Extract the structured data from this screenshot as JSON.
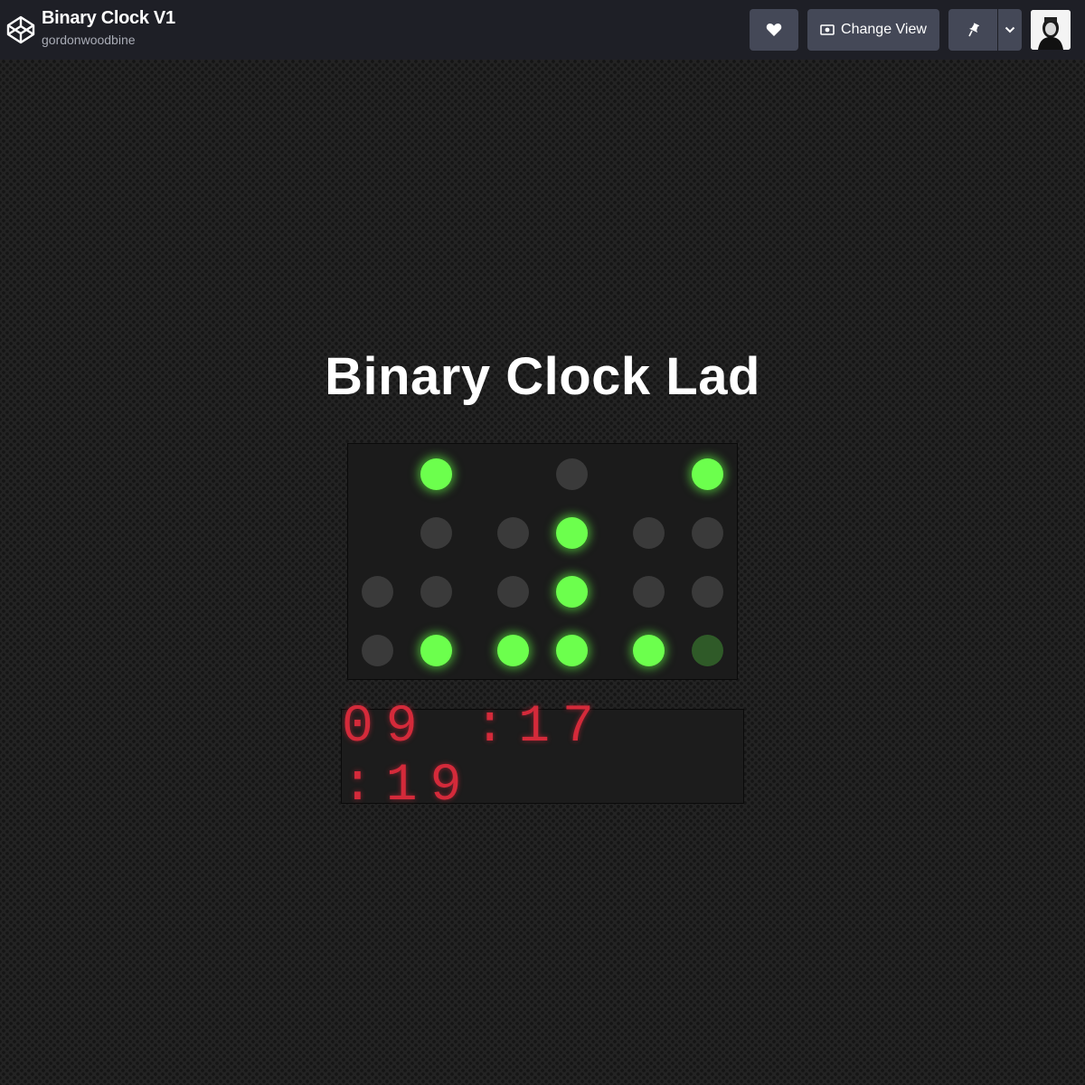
{
  "header": {
    "pen_title": "Binary Clock V1",
    "author": "gordonwoodbine",
    "change_view_label": "Change View",
    "icons": [
      "codepen-logo-icon",
      "heart-icon",
      "eye-icon",
      "pin-icon",
      "chevron-down-icon",
      "avatar"
    ]
  },
  "main": {
    "heading": "Binary Clock Lad",
    "digital_time": "09 :17 :19",
    "binary_columns": [
      {
        "digit": "hours-tens",
        "bits": [
          null,
          null,
          0,
          0
        ]
      },
      {
        "digit": "hours-ones",
        "bits": [
          1,
          0,
          0,
          1
        ]
      },
      {
        "digit": "minutes-tens",
        "bits": [
          null,
          0,
          0,
          1
        ]
      },
      {
        "digit": "minutes-ones",
        "bits": [
          0,
          1,
          1,
          1
        ]
      },
      {
        "digit": "seconds-tens",
        "bits": [
          null,
          0,
          0,
          1
        ]
      },
      {
        "digit": "seconds-ones",
        "bits": [
          1,
          0,
          0,
          "dim"
        ]
      }
    ]
  },
  "colors": {
    "led_on": "#6cff4d",
    "led_off": "#3a3a3a",
    "digital_text": "#d42a3a",
    "topbar": "#1e1f26",
    "button": "#444857"
  }
}
